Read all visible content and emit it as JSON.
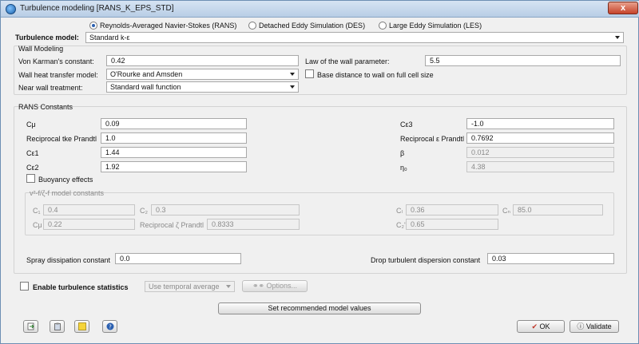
{
  "window": {
    "title": "Turbulence modeling [RANS_K_EPS_STD]",
    "close_label": "x"
  },
  "simulation_type": {
    "options": [
      "Reynolds-Averaged Navier-Stokes (RANS)",
      "Detached Eddy Simulation (DES)",
      "Large Eddy Simulation (LES)"
    ],
    "selected_index": 0
  },
  "turbulence_model": {
    "label": "Turbulence model:",
    "value": "Standard k-ε"
  },
  "wall_modeling": {
    "title": "Wall Modeling",
    "von_karman_label": "Von Karman's constant:",
    "von_karman_value": "0.42",
    "law_of_wall_label": "Law of the wall parameter:",
    "law_of_wall_value": "5.5",
    "heat_transfer_label": "Wall heat transfer model:",
    "heat_transfer_value": "O'Rourke and Amsden",
    "base_distance_label": "Base distance to wall on full cell size",
    "near_wall_label": "Near wall treatment:",
    "near_wall_value": "Standard wall function"
  },
  "rans": {
    "title": "RANS Constants",
    "c_mu_label": "Cμ",
    "c_mu_value": "0.09",
    "recip_tke_label": "Reciprocal tke Prandtl",
    "recip_tke_value": "1.0",
    "c_e1_label": "Cε1",
    "c_e1_value": "1.44",
    "c_e2_label": "Cε2",
    "c_e2_value": "1.92",
    "c_e3_label": "Cε3",
    "c_e3_value": "-1.0",
    "recip_eps_label": "Reciprocal ε Prandtl",
    "recip_eps_value": "0.7692",
    "beta_label": "β",
    "beta_value": "0.012",
    "eta0_label": "η₀",
    "eta0_value": "4.38",
    "buoyancy_label": "Buoyancy effects"
  },
  "v2f": {
    "title": "v²-f/ζ-f model constants",
    "c1_label": "C₁",
    "c1_value": "0.4",
    "c2_label": "C₂",
    "c2_value": "0.3",
    "cl_label": "Cₗ",
    "cl_value": "0.36",
    "cn_label": "Cₙ",
    "cn_value": "85.0",
    "cmu_label": "Cμ",
    "cmu_value": "0.22",
    "recip_zeta_label": "Reciprocal ζ Prandtl",
    "recip_zeta_value": "0.8333",
    "c2p_label": "C₂'",
    "c2p_value": "0.65"
  },
  "spray": {
    "dissipation_label": "Spray dissipation constant",
    "dissipation_value": "0.0",
    "dispersion_label": "Drop turbulent dispersion constant",
    "dispersion_value": "0.03"
  },
  "statistics": {
    "enable_label": "Enable turbulence statistics",
    "mode_value": "Use temporal average",
    "options_label": "Options..."
  },
  "footer": {
    "recommended_label": "Set recommended model values",
    "ok_label": "OK",
    "validate_label": "Validate"
  },
  "colors": {
    "accent": "#2a5fb0",
    "ok": "#c0392b"
  }
}
